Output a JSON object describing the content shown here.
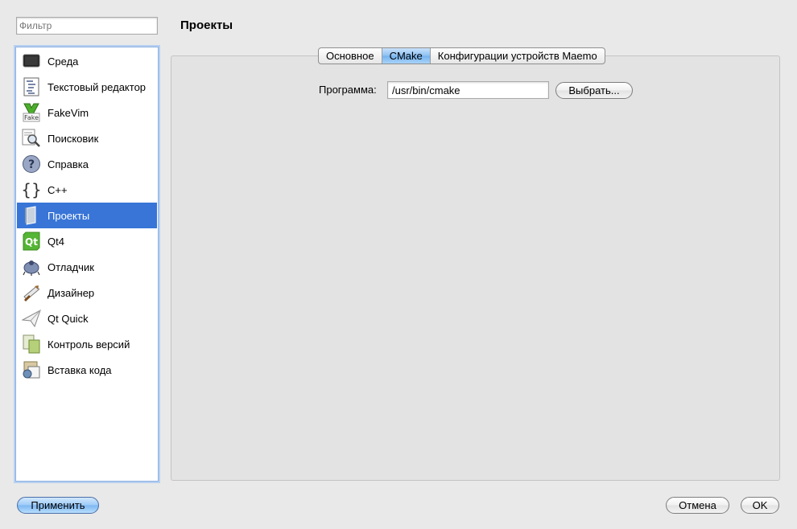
{
  "filter": {
    "placeholder": "Фильтр"
  },
  "sidebar": {
    "items": [
      {
        "label": "Среда",
        "icon": "monitor-icon"
      },
      {
        "label": "Текстовый редактор",
        "icon": "text-editor-icon"
      },
      {
        "label": "FakeVim",
        "icon": "fakevim-icon"
      },
      {
        "label": "Поисковик",
        "icon": "locator-icon"
      },
      {
        "label": "Справка",
        "icon": "help-icon"
      },
      {
        "label": "C++",
        "icon": "braces-icon"
      },
      {
        "label": "Проекты",
        "icon": "projects-icon"
      },
      {
        "label": "Qt4",
        "icon": "qt-icon"
      },
      {
        "label": "Отладчик",
        "icon": "bug-icon"
      },
      {
        "label": "Дизайнер",
        "icon": "designer-icon"
      },
      {
        "label": "Qt Quick",
        "icon": "paper-plane-icon"
      },
      {
        "label": "Контроль версий",
        "icon": "version-control-icon"
      },
      {
        "label": "Вставка кода",
        "icon": "snippets-icon"
      }
    ],
    "selected_index": 6
  },
  "page": {
    "title": "Проекты"
  },
  "tabs": [
    {
      "label": "Основное"
    },
    {
      "label": "CMake"
    },
    {
      "label": "Конфигурации устройств Maemo"
    }
  ],
  "active_tab": 1,
  "cmake": {
    "program_label": "Программа:",
    "program_value": "/usr/bin/cmake",
    "browse_label": "Выбрать..."
  },
  "footer": {
    "apply_label": "Применить",
    "cancel_label": "Отмена",
    "ok_label": "OK"
  },
  "colors": {
    "selection": "#3875d7",
    "active_tab": "#8cc0f3",
    "sidebar_focus": "#8db2e3"
  }
}
